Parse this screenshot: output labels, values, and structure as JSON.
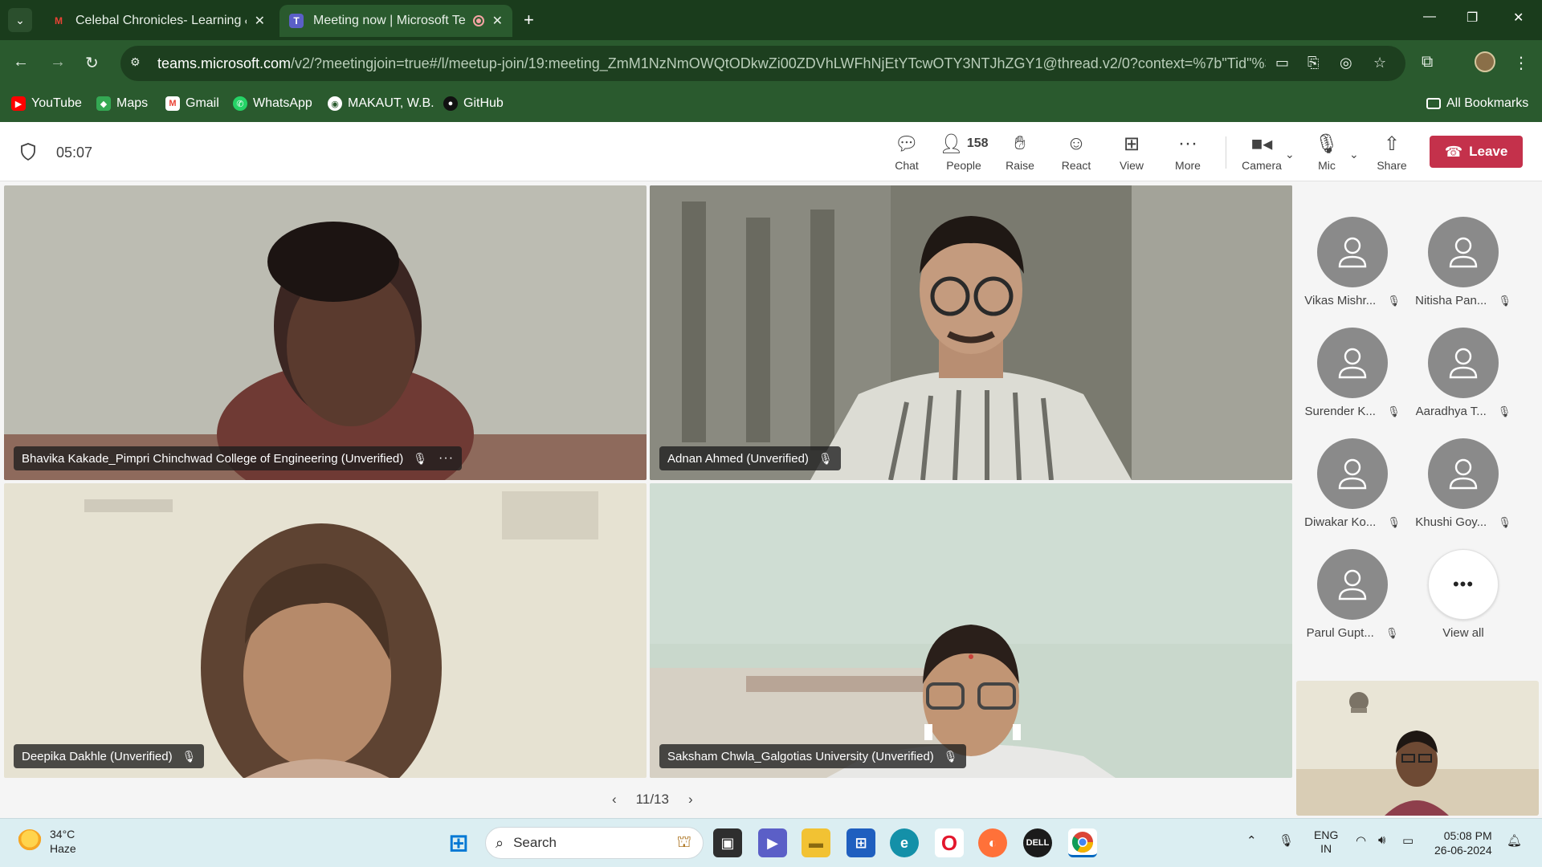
{
  "browser": {
    "tabs": [
      {
        "title": "Celebal Chronicles- Learning &",
        "favicon": "gmail-icon"
      },
      {
        "title": "Meeting now | Microsoft Te",
        "favicon": "teams-icon",
        "recording": true
      }
    ],
    "url_domain": "teams.microsoft.com",
    "url_path": "/v2/?meetingjoin=true#/l/meetup-join/19:meeting_ZmM1NzNmOWQtODkwZi00ZDVhLWFhNjEtYTcwOTY3NTJhZGY1@thread.v2/0?context=%7b\"Tid\"%3a\"e...",
    "bookmarks": [
      "YouTube",
      "Maps",
      "Gmail",
      "WhatsApp",
      "MAKAUT, W.B.",
      "GitHub"
    ],
    "all_bookmarks": "All Bookmarks"
  },
  "meeting": {
    "timer": "05:07",
    "toolbar": {
      "chat": "Chat",
      "people": "People",
      "people_count": "158",
      "raise": "Raise",
      "react": "React",
      "view": "View",
      "more": "More",
      "camera": "Camera",
      "mic": "Mic",
      "share": "Share",
      "leave": "Leave"
    },
    "tiles": [
      {
        "name": "Bhavika Kakade_Pimpri Chinchwad College of Engineering (Unverified)"
      },
      {
        "name": "Adnan Ahmed (Unverified)"
      },
      {
        "name": "Deepika Dakhle (Unverified)"
      },
      {
        "name": "Saksham Chwla_Galgotias University (Unverified)"
      }
    ],
    "pager": "11/13",
    "roster": [
      "Vikas Mishr...",
      "Nitisha Pan...",
      "Surender K...",
      "Aaradhya T...",
      "Diwakar Ko...",
      "Khushi Goy...",
      "Parul Gupt..."
    ],
    "view_all": "View all"
  },
  "taskbar": {
    "weather_temp": "34°C",
    "weather_desc": "Haze",
    "search": "Search",
    "lang_line1": "ENG",
    "lang_line2": "IN",
    "time": "05:08 PM",
    "date": "26-06-2024"
  },
  "colors": {
    "chrome_dark": "#1a3c1c",
    "chrome": "#2a5a2e",
    "leave_red": "#c4314b",
    "taskbar": "#dbeef2"
  }
}
